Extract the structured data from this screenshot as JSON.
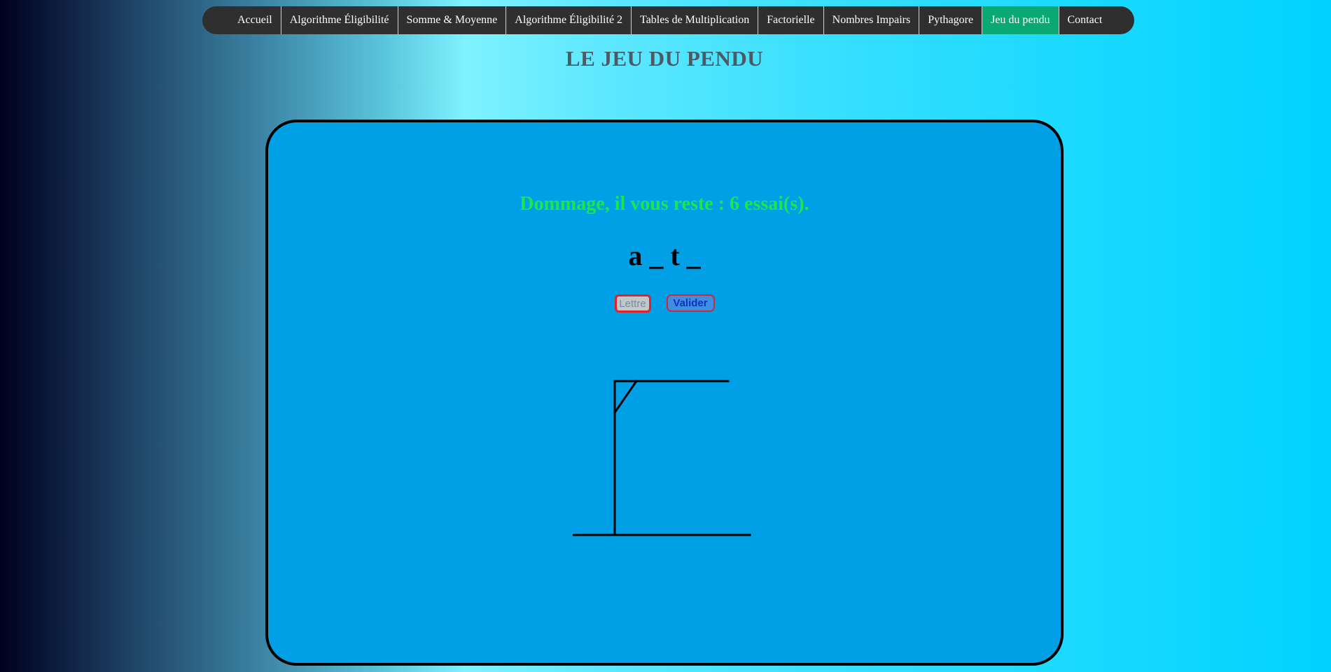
{
  "nav": {
    "items": [
      {
        "label": "Accueil",
        "active": false
      },
      {
        "label": "Algorithme Éligibilité",
        "active": false
      },
      {
        "label": "Somme & Moyenne",
        "active": false
      },
      {
        "label": "Algorithme Éligibilité 2",
        "active": false
      },
      {
        "label": "Tables de Multiplication",
        "active": false
      },
      {
        "label": "Factorielle",
        "active": false
      },
      {
        "label": "Nombres Impairs",
        "active": false
      },
      {
        "label": "Pythagore",
        "active": false
      },
      {
        "label": "Jeu du pendu",
        "active": true
      },
      {
        "label": "Contact",
        "active": false
      }
    ],
    "colors": {
      "background": "#2f2f2f",
      "active": "#0aa872",
      "text": "#ffffff"
    }
  },
  "page": {
    "title": "LE JEU DU PENDU"
  },
  "game": {
    "message": "Dommage, il vous reste : 6 essai(s).",
    "word": "a _ t _",
    "input": {
      "placeholder": "Lettre",
      "value": ""
    },
    "validate_label": "Valider",
    "hangman_icon": "hangman-gallows",
    "colors": {
      "panel": "#01a0e6",
      "message": "#17e852",
      "border": "#000000"
    }
  }
}
